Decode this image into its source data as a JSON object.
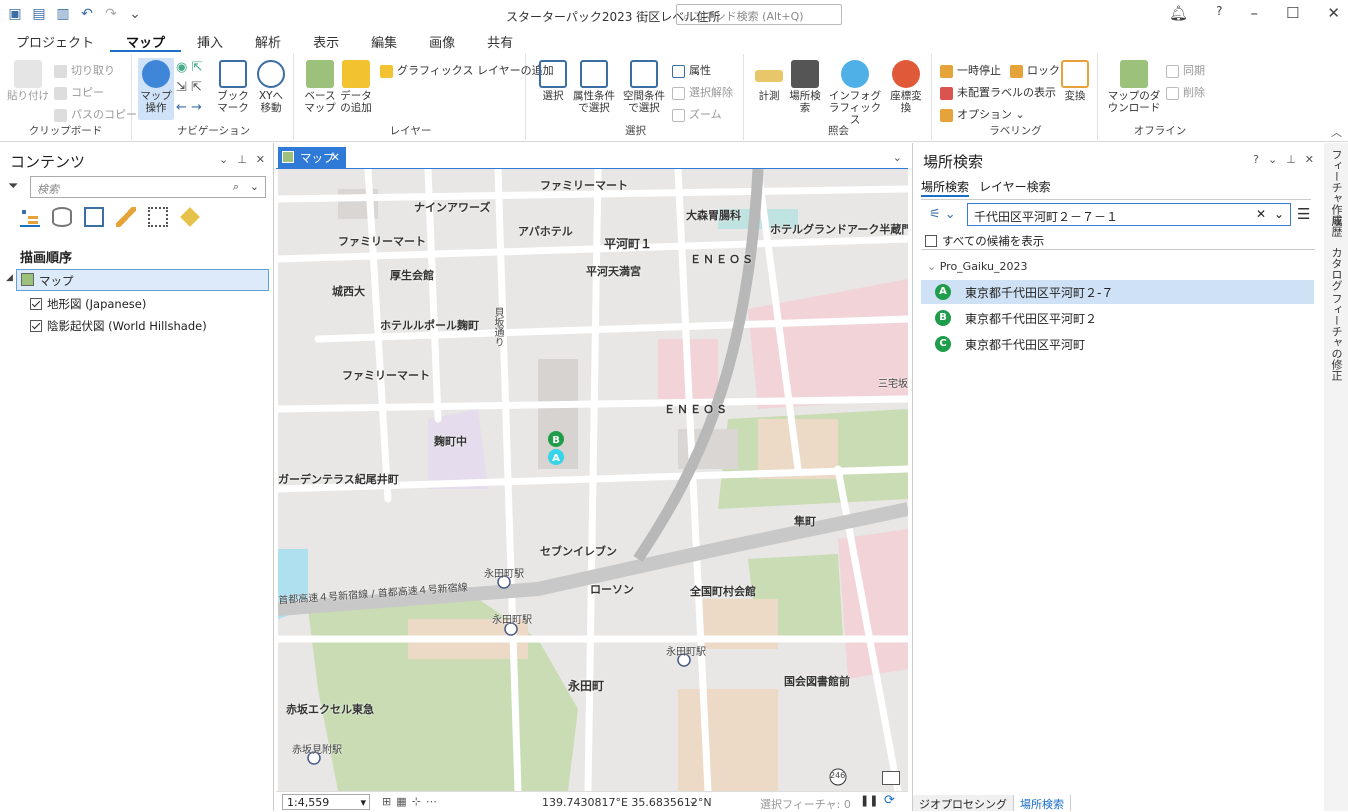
{
  "app": {
    "title": "スターターパック2023 街区レベル住所",
    "command_search_placeholder": "コマンド検索 (Alt+Q)"
  },
  "ribbon_tabs": [
    "プロジェクト",
    "マップ",
    "挿入",
    "解析",
    "表示",
    "編集",
    "画像",
    "共有"
  ],
  "ribbon": {
    "clipboard": {
      "title": "クリップボード",
      "paste": "貼り付け",
      "cut": "切り取り",
      "copy": "コピー",
      "copy_path": "パスのコピー"
    },
    "navigation": {
      "title": "ナビゲーション",
      "explore": "マップ操作",
      "bookmarks": "ブックマーク",
      "goto_xy": "XYへ移動"
    },
    "layer": {
      "title": "レイヤー",
      "basemap": "ベースマップ",
      "add_data": "データの追加",
      "add_graphics": "グラフィックス レイヤーの追加"
    },
    "selection": {
      "title": "選択",
      "select": "選択",
      "by_attr": "属性条件で選択",
      "by_loc": "空間条件で選択",
      "attributes": "属性",
      "clear": "選択解除",
      "zoom": "ズーム"
    },
    "inquiry": {
      "title": "照会",
      "measure": "計測",
      "locate": "場所検索",
      "infographics": "インフォグラフィックス",
      "convert_coord": "座標変換"
    },
    "labeling": {
      "title": "ラベリング",
      "pause": "一時停止",
      "lock": "ロック",
      "unplaced": "未配置ラベルの表示",
      "options": "オプション",
      "convert": "変換"
    },
    "offline": {
      "title": "オフライン",
      "download": "マップのダウンロード",
      "sync": "同期",
      "remove": "削除"
    }
  },
  "contents": {
    "title": "コンテンツ",
    "search_placeholder": "検索",
    "drawing_order": "描画順序",
    "map_name": "マップ",
    "layers": [
      {
        "name": "地形図 (Japanese)",
        "checked": true
      },
      {
        "name": "陰影起伏図 (World Hillshade)",
        "checked": true
      }
    ]
  },
  "map_view": {
    "tab": "マップ",
    "labels": [
      "ファミリーマート",
      "ナインアワーズ",
      "大森胃腸科",
      "アパホテル",
      "平河町１",
      "ホテルグランドアーク半蔵門",
      "ファミリーマート",
      "厚生会館",
      "ＥＮＥＯＳ",
      "平河天満宮",
      "城西大",
      "貝坂通り",
      "ホテルルポール麹町",
      "ファミリーマート",
      "ＥＮＥＯＳ",
      "三宅坂",
      "麹町中",
      "ガーデンテラス紀尾井町",
      "隼町",
      "セブンイレブン",
      "永田町駅",
      "首都高速４号新宿線 / 首都高速４号新宿線",
      "ローソン",
      "全国町村会館",
      "永田町駅",
      "永田町駅",
      "永田町",
      "国会図書館前",
      "赤坂エクセル東急",
      "赤坂見附駅",
      "246"
    ],
    "markers": [
      "B",
      "A"
    ],
    "scale": "1:4,559",
    "coords": "139.7430817°E 35.6835612°N",
    "selected_features": "選択フィーチャ: 0"
  },
  "locate": {
    "title": "場所検索",
    "tabs": [
      "場所検索",
      "レイヤー検索"
    ],
    "query": "千代田区平河町２－７－１",
    "show_all": "すべての候補を表示",
    "group": "Pro_Gaiku_2023",
    "results": [
      {
        "badge": "A",
        "text": "東京都千代田区平河町２-７"
      },
      {
        "badge": "B",
        "text": "東京都千代田区平河町２"
      },
      {
        "badge": "C",
        "text": "東京都千代田区平河町"
      }
    ],
    "bottom_tabs": [
      "ジオプロセシング",
      "場所検索"
    ]
  },
  "side_tabs": [
    "フィーチャ作成",
    "履歴",
    "カタログ",
    "フィーチャの修正"
  ],
  "colors": {
    "accent": "#1a6fc9",
    "badge": "#1f9d4a",
    "map_park": "#c9dcb4",
    "map_road": "#ffffff"
  }
}
